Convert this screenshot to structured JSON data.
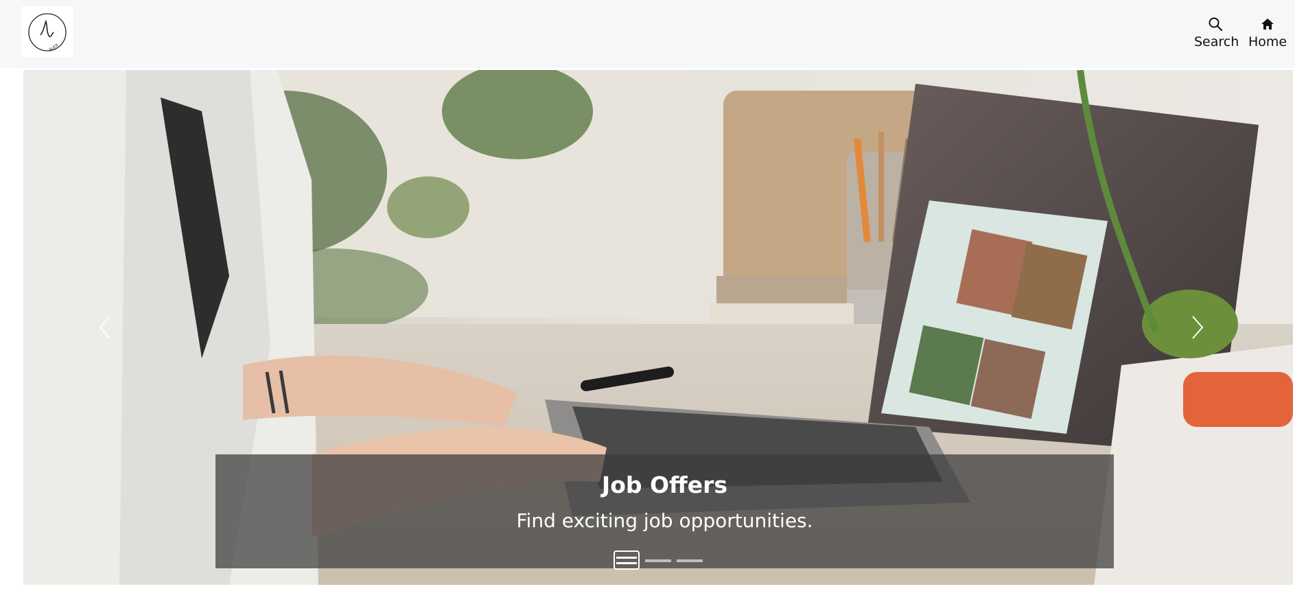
{
  "header": {
    "logo_text": "ALEX",
    "nav": [
      {
        "label": "Search",
        "icon": "search-icon"
      },
      {
        "label": "Home",
        "icon": "home-icon"
      }
    ]
  },
  "carousel": {
    "slides": [
      {
        "title": "Job Offers",
        "text": "Find exciting job opportunities."
      }
    ],
    "active_index": 0,
    "indicator_count": 3
  }
}
